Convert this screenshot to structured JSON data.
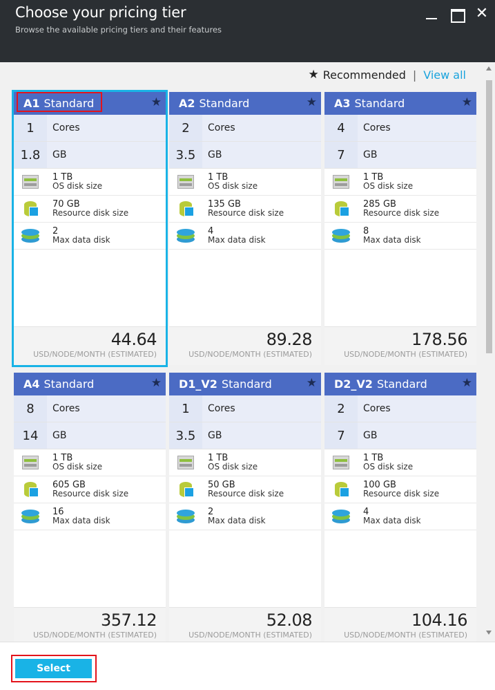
{
  "window": {
    "title": "Choose your pricing tier",
    "subtitle": "Browse the available pricing tiers and their features",
    "close_glyph": "✕"
  },
  "toolbar": {
    "recommended_star": "★",
    "recommended_label": "Recommended",
    "separator": "|",
    "view_all_label": "View all"
  },
  "tiers": [
    {
      "code": "A1",
      "name": "Standard",
      "star": "★",
      "cores": "1",
      "cores_label": "Cores",
      "ram": "1.8",
      "ram_label": "GB",
      "os_disk": "1 TB",
      "os_disk_label": "OS disk size",
      "res_disk": "70 GB",
      "res_disk_label": "Resource disk size",
      "max_disk": "2",
      "max_disk_label": "Max data disk",
      "price": "44.64",
      "price_unit": "USD/NODE/MONTH (ESTIMATED)",
      "selected": true
    },
    {
      "code": "A2",
      "name": "Standard",
      "star": "★",
      "cores": "2",
      "cores_label": "Cores",
      "ram": "3.5",
      "ram_label": "GB",
      "os_disk": "1 TB",
      "os_disk_label": "OS disk size",
      "res_disk": "135 GB",
      "res_disk_label": "Resource disk size",
      "max_disk": "4",
      "max_disk_label": "Max data disk",
      "price": "89.28",
      "price_unit": "USD/NODE/MONTH (ESTIMATED)",
      "selected": false
    },
    {
      "code": "A3",
      "name": "Standard",
      "star": "★",
      "cores": "4",
      "cores_label": "Cores",
      "ram": "7",
      "ram_label": "GB",
      "os_disk": "1 TB",
      "os_disk_label": "OS disk size",
      "res_disk": "285 GB",
      "res_disk_label": "Resource disk size",
      "max_disk": "8",
      "max_disk_label": "Max data disk",
      "price": "178.56",
      "price_unit": "USD/NODE/MONTH (ESTIMATED)",
      "selected": false
    },
    {
      "code": "A4",
      "name": "Standard",
      "star": "★",
      "cores": "8",
      "cores_label": "Cores",
      "ram": "14",
      "ram_label": "GB",
      "os_disk": "1 TB",
      "os_disk_label": "OS disk size",
      "res_disk": "605 GB",
      "res_disk_label": "Resource disk size",
      "max_disk": "16",
      "max_disk_label": "Max data disk",
      "price": "357.12",
      "price_unit": "USD/NODE/MONTH (ESTIMATED)",
      "selected": false
    },
    {
      "code": "D1_V2",
      "name": "Standard",
      "star": "★",
      "cores": "1",
      "cores_label": "Cores",
      "ram": "3.5",
      "ram_label": "GB",
      "os_disk": "1 TB",
      "os_disk_label": "OS disk size",
      "res_disk": "50 GB",
      "res_disk_label": "Resource disk size",
      "max_disk": "2",
      "max_disk_label": "Max data disk",
      "price": "52.08",
      "price_unit": "USD/NODE/MONTH (ESTIMATED)",
      "selected": false
    },
    {
      "code": "D2_V2",
      "name": "Standard",
      "star": "★",
      "cores": "2",
      "cores_label": "Cores",
      "ram": "7",
      "ram_label": "GB",
      "os_disk": "1 TB",
      "os_disk_label": "OS disk size",
      "res_disk": "100 GB",
      "res_disk_label": "Resource disk size",
      "max_disk": "4",
      "max_disk_label": "Max data disk",
      "price": "104.16",
      "price_unit": "USD/NODE/MONTH (ESTIMATED)",
      "selected": false
    }
  ],
  "footer": {
    "select_label": "Select"
  },
  "colors": {
    "header_bg": "#2b2f33",
    "tier_header": "#4b6bc4",
    "accent": "#19b3e6",
    "highlight_red": "#e3131b"
  }
}
